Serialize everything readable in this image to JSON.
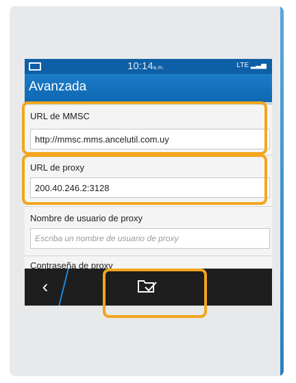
{
  "status": {
    "time": "10:14",
    "ampm": "a.m.",
    "network": "LTE"
  },
  "header": {
    "title": "Avanzada"
  },
  "fields": {
    "mmsc": {
      "label": "URL de MMSC",
      "value": "http://mmsc.mms.ancelutil.com.uy"
    },
    "proxy": {
      "label": "URL de proxy",
      "value": "200.40.246.2:3128"
    },
    "proxy_user": {
      "label": "Nombre de usuario de proxy",
      "placeholder": "Escriba un nombre de usuario de proxy"
    },
    "proxy_pass": {
      "label": "Contraseña de proxy"
    }
  },
  "icons": {
    "back": "chevron-left-icon",
    "save": "folder-check-icon",
    "battery": "battery-icon",
    "signal": "signal-icon"
  },
  "colors": {
    "header": "#0f67b2",
    "statusbar": "#0d5fa6",
    "highlight": "#f2a51c",
    "bottombar": "#1e1e1e",
    "accent": "#1b8de0"
  }
}
